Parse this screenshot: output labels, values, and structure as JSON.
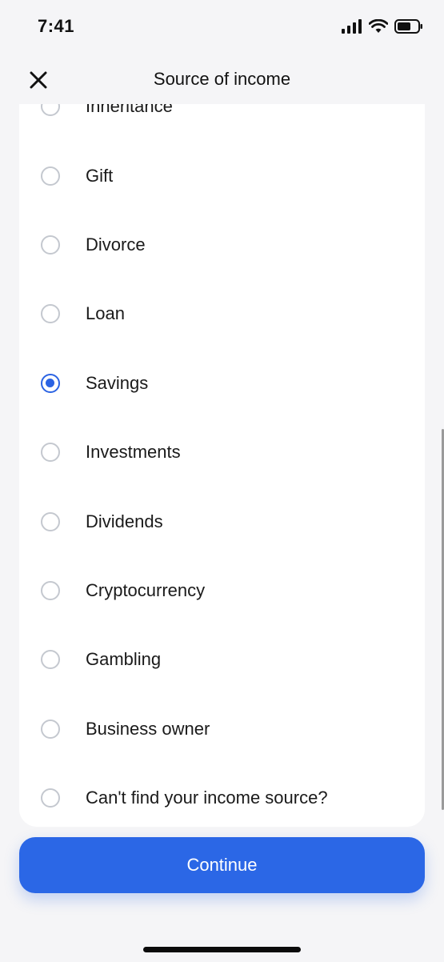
{
  "status_bar": {
    "time": "7:41"
  },
  "header": {
    "title": "Source of income"
  },
  "options": [
    {
      "label": "Inheritance",
      "selected": false
    },
    {
      "label": "Gift",
      "selected": false
    },
    {
      "label": "Divorce",
      "selected": false
    },
    {
      "label": "Loan",
      "selected": false
    },
    {
      "label": "Savings",
      "selected": true
    },
    {
      "label": "Investments",
      "selected": false
    },
    {
      "label": "Dividends",
      "selected": false
    },
    {
      "label": "Cryptocurrency",
      "selected": false
    },
    {
      "label": "Gambling",
      "selected": false
    },
    {
      "label": "Business owner",
      "selected": false
    },
    {
      "label": "Can't find your income source?",
      "selected": false
    }
  ],
  "footer": {
    "continue_label": "Continue"
  },
  "colors": {
    "accent": "#2b67e6",
    "background": "#f5f5f7"
  }
}
